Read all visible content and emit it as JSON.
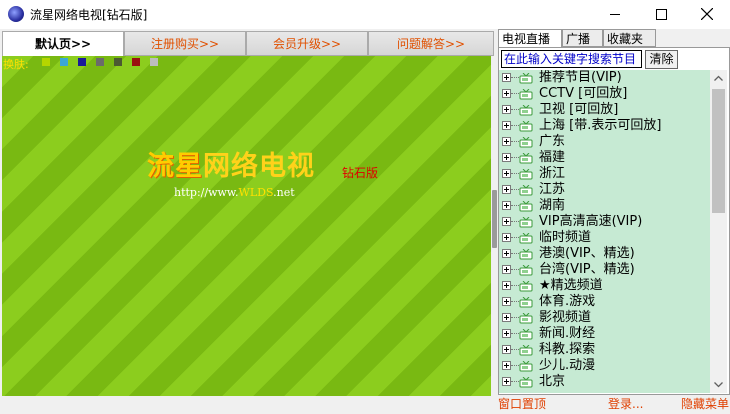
{
  "window": {
    "title": "流星网络电视[钻石版]"
  },
  "top_tabs": [
    {
      "label": "默认页>>",
      "active": true
    },
    {
      "label": "注册购买>>",
      "active": false
    },
    {
      "label": "会员升级>>",
      "active": false
    },
    {
      "label": "问题解答>>",
      "active": false
    }
  ],
  "skin": {
    "label": "换肤:",
    "colors": [
      "#b5d600",
      "#3ba7d6",
      "#1a1a9a",
      "#6b6b6b",
      "#4b5a32",
      "#9a1010",
      "#bdbdbd"
    ]
  },
  "logo": {
    "part1": "流星",
    "part2": "网络电视",
    "tag": "钻石版",
    "url_prefix": "http://www.",
    "url_highlight": "WLDS",
    "url_suffix": ".net"
  },
  "side_tabs": [
    {
      "label": "电视直播",
      "active": true
    },
    {
      "label": "广播",
      "active": false
    },
    {
      "label": "收藏夹",
      "active": false
    }
  ],
  "search": {
    "placeholder": "在此输入关键字搜索节目",
    "button": "清除"
  },
  "channels": [
    "推荐节目(VIP)",
    "CCTV [可回放]",
    "卫视 [可回放]",
    "上海 [带.表示可回放]",
    "广东",
    "福建",
    "浙江",
    "江苏",
    "湖南",
    "VIP高清高速(VIP)",
    "临时频道",
    "港澳(VIP、精选)",
    "台湾(VIP、精选)",
    "★精选频道",
    "体育.游戏",
    "影视频道",
    "新闻.财经",
    "科教.探索",
    "少儿.动漫",
    "北京"
  ],
  "status": {
    "pin": "窗口置顶",
    "login": "登录...",
    "hide": "隐藏菜单"
  },
  "colors": {
    "accent": "#e04000",
    "tree_bg": "#c6ead3"
  }
}
